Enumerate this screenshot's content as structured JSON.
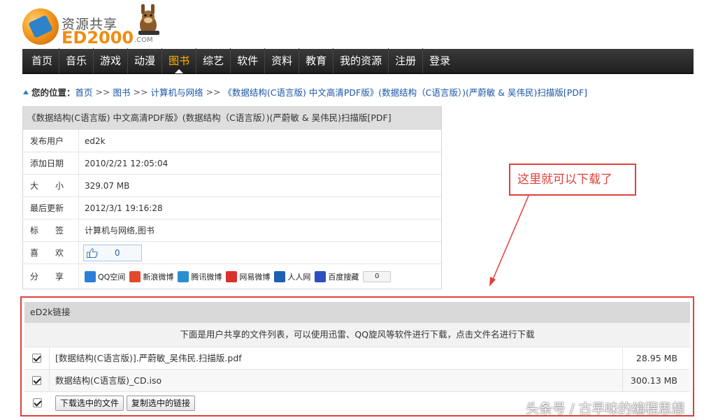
{
  "logo": {
    "cn": "资源共享",
    "en": "ED2000",
    "com": ".COM"
  },
  "nav": {
    "items": [
      "首页",
      "音乐",
      "游戏",
      "动漫",
      "图书",
      "综艺",
      "软件",
      "资料",
      "教育",
      "我的资源",
      "注册",
      "登录"
    ],
    "active": "图书"
  },
  "breadcrumb": {
    "label": "您的位置：",
    "links": [
      "首页",
      "图书",
      "计算机与网络",
      "《数据结构(C语言版) 中文高清PDF版》(数据结构（C语言版）)(严蔚敏 & 吴伟民)扫描版[PDF]"
    ],
    "sep": ">>"
  },
  "info": {
    "title": "《数据结构(C语言版) 中文高清PDF版》(数据结构（C语言版）)(严蔚敏 & 吴伟民)扫描版[PDF]",
    "rows": [
      {
        "key": "发布用户",
        "value": "ed2k"
      },
      {
        "key": "添加日期",
        "value": "2010/2/21 12:05:04"
      },
      {
        "key": "大　　小",
        "value": "329.07 MB"
      },
      {
        "key": "最后更新",
        "value": "2012/3/1 19:16:28"
      },
      {
        "key": "标　　签",
        "value": "计算机与网络,图书"
      }
    ],
    "like_key": "喜　　欢",
    "like_count": "0",
    "share_key": "分　　享",
    "share": [
      {
        "name": "QQ空间",
        "color": "#2c7fd6"
      },
      {
        "name": "新浪微博",
        "color": "#e24a2b"
      },
      {
        "name": "腾讯微博",
        "color": "#2a8fd0"
      },
      {
        "name": "网易微博",
        "color": "#d9312b"
      },
      {
        "name": "人人网",
        "color": "#1f5fb4"
      },
      {
        "name": "百度搜藏",
        "color": "#2c4fc2"
      }
    ],
    "share_count": "0"
  },
  "callout": {
    "text": "这里就可以下载了",
    "color": "#e0403a"
  },
  "ed2k": {
    "header": "eD2k链接",
    "notice": "下面是用户共享的文件列表，可以使用迅雷、QQ旋风等软件进行下载，点击文件名进行下载",
    "files": [
      {
        "name": "[数据结构(C语言版)].严蔚敏_吴伟民.扫描版.pdf",
        "size": "28.95 MB"
      },
      {
        "name": "数据结构(C语言版)_CD.iso",
        "size": "300.13 MB"
      }
    ],
    "buttons": {
      "download": "下载选中的文件",
      "copy": "复制选中的链接"
    }
  },
  "watermark": "头条号 / 古早味的编程思想"
}
